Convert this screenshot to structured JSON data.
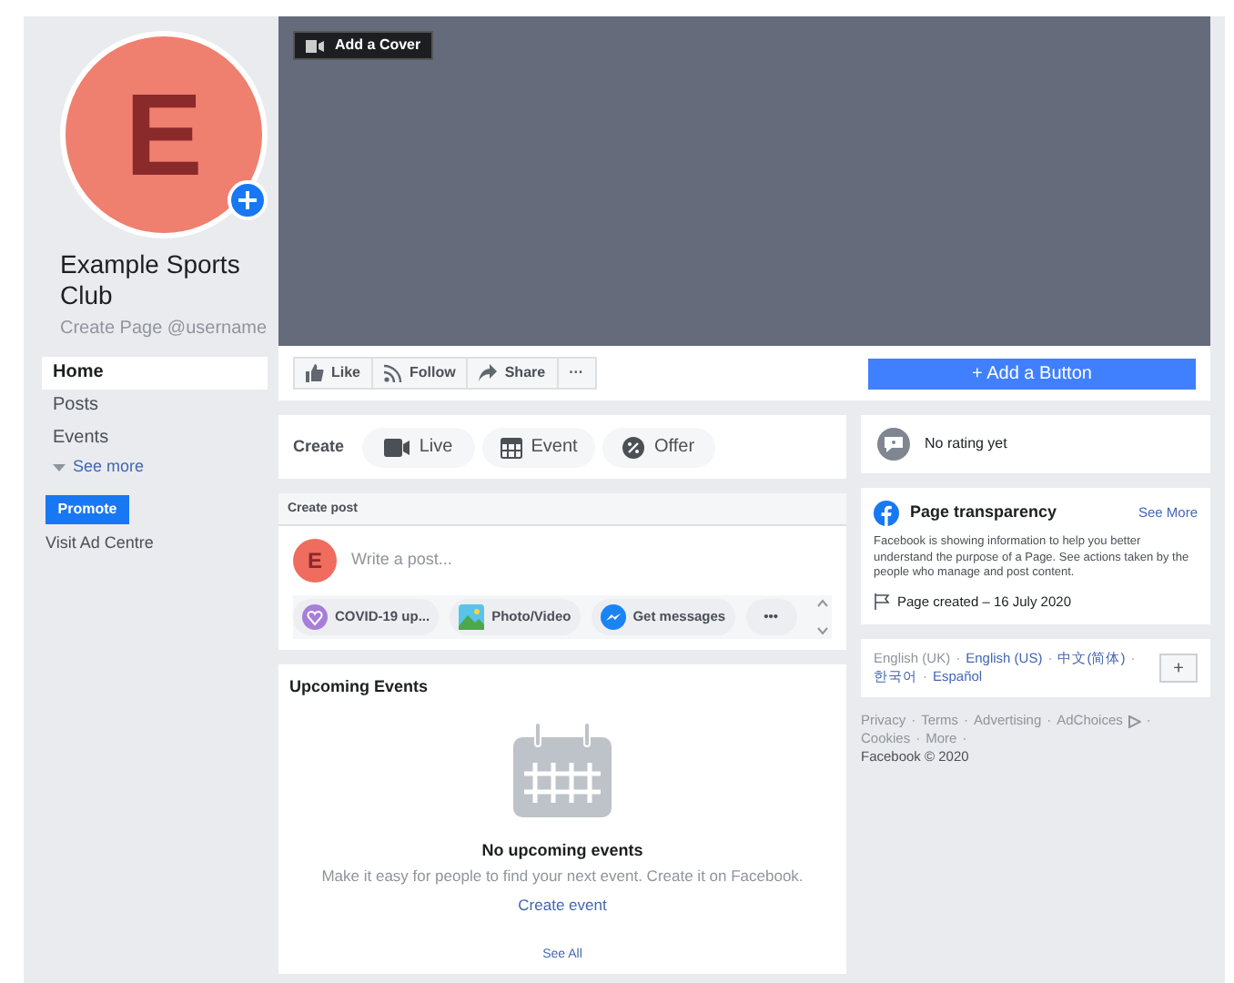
{
  "profile": {
    "initial": "E",
    "name": "Example Sports Club",
    "username": "Create Page @username"
  },
  "nav": [
    {
      "label": "Home",
      "selected": true
    },
    {
      "label": "Posts",
      "selected": false
    },
    {
      "label": "Events",
      "selected": false
    }
  ],
  "see_more": "See more",
  "promote": "Promote",
  "visit_ad_centre": "Visit Ad Centre",
  "cover": {
    "add_cover": "Add a Cover"
  },
  "actions": [
    {
      "kind": "like",
      "label": "Like"
    },
    {
      "kind": "follow",
      "label": "Follow"
    },
    {
      "kind": "share",
      "label": "Share"
    },
    {
      "kind": "more",
      "label": "···"
    }
  ],
  "add_button": "+ Add a Button",
  "create": {
    "label": "Create",
    "items": [
      {
        "kind": "live",
        "label": "Live"
      },
      {
        "kind": "event",
        "label": "Event"
      },
      {
        "kind": "offer",
        "label": "Offer"
      }
    ]
  },
  "create_post": {
    "title": "Create post",
    "initial": "E",
    "placeholder": "Write a post...",
    "chips": [
      {
        "kind": "covid",
        "label": "COVID-19 up..."
      },
      {
        "kind": "photo",
        "label": "Photo/Video"
      },
      {
        "kind": "messages",
        "label": "Get messages"
      },
      {
        "kind": "more",
        "label": "•••"
      }
    ]
  },
  "events": {
    "title": "Upcoming Events",
    "empty_title": "No upcoming events",
    "empty_text": "Make it easy for people to find your next event. Create it on Facebook.",
    "create_link": "Create event",
    "see_all": "See All"
  },
  "rating": "No rating yet",
  "transparency": {
    "title": "Page transparency",
    "see_more": "See More",
    "text": "Facebook is showing information to help you better understand the purpose of a Page. See actions taken by the people who manage and post content.",
    "created": "Page created – 16 July 2020"
  },
  "languages": [
    {
      "label": "English (UK)",
      "selected": true
    },
    {
      "label": "English (US)",
      "selected": false
    },
    {
      "label": "中文(简体)",
      "selected": false
    },
    {
      "label": "한국어",
      "selected": false
    },
    {
      "label": "Español",
      "selected": false
    }
  ],
  "separator": "·",
  "add_language": "+",
  "footer_links": [
    "Privacy",
    "Terms",
    "Advertising",
    "AdChoices",
    "Cookies",
    "More"
  ],
  "copyright": "Facebook © 2020"
}
